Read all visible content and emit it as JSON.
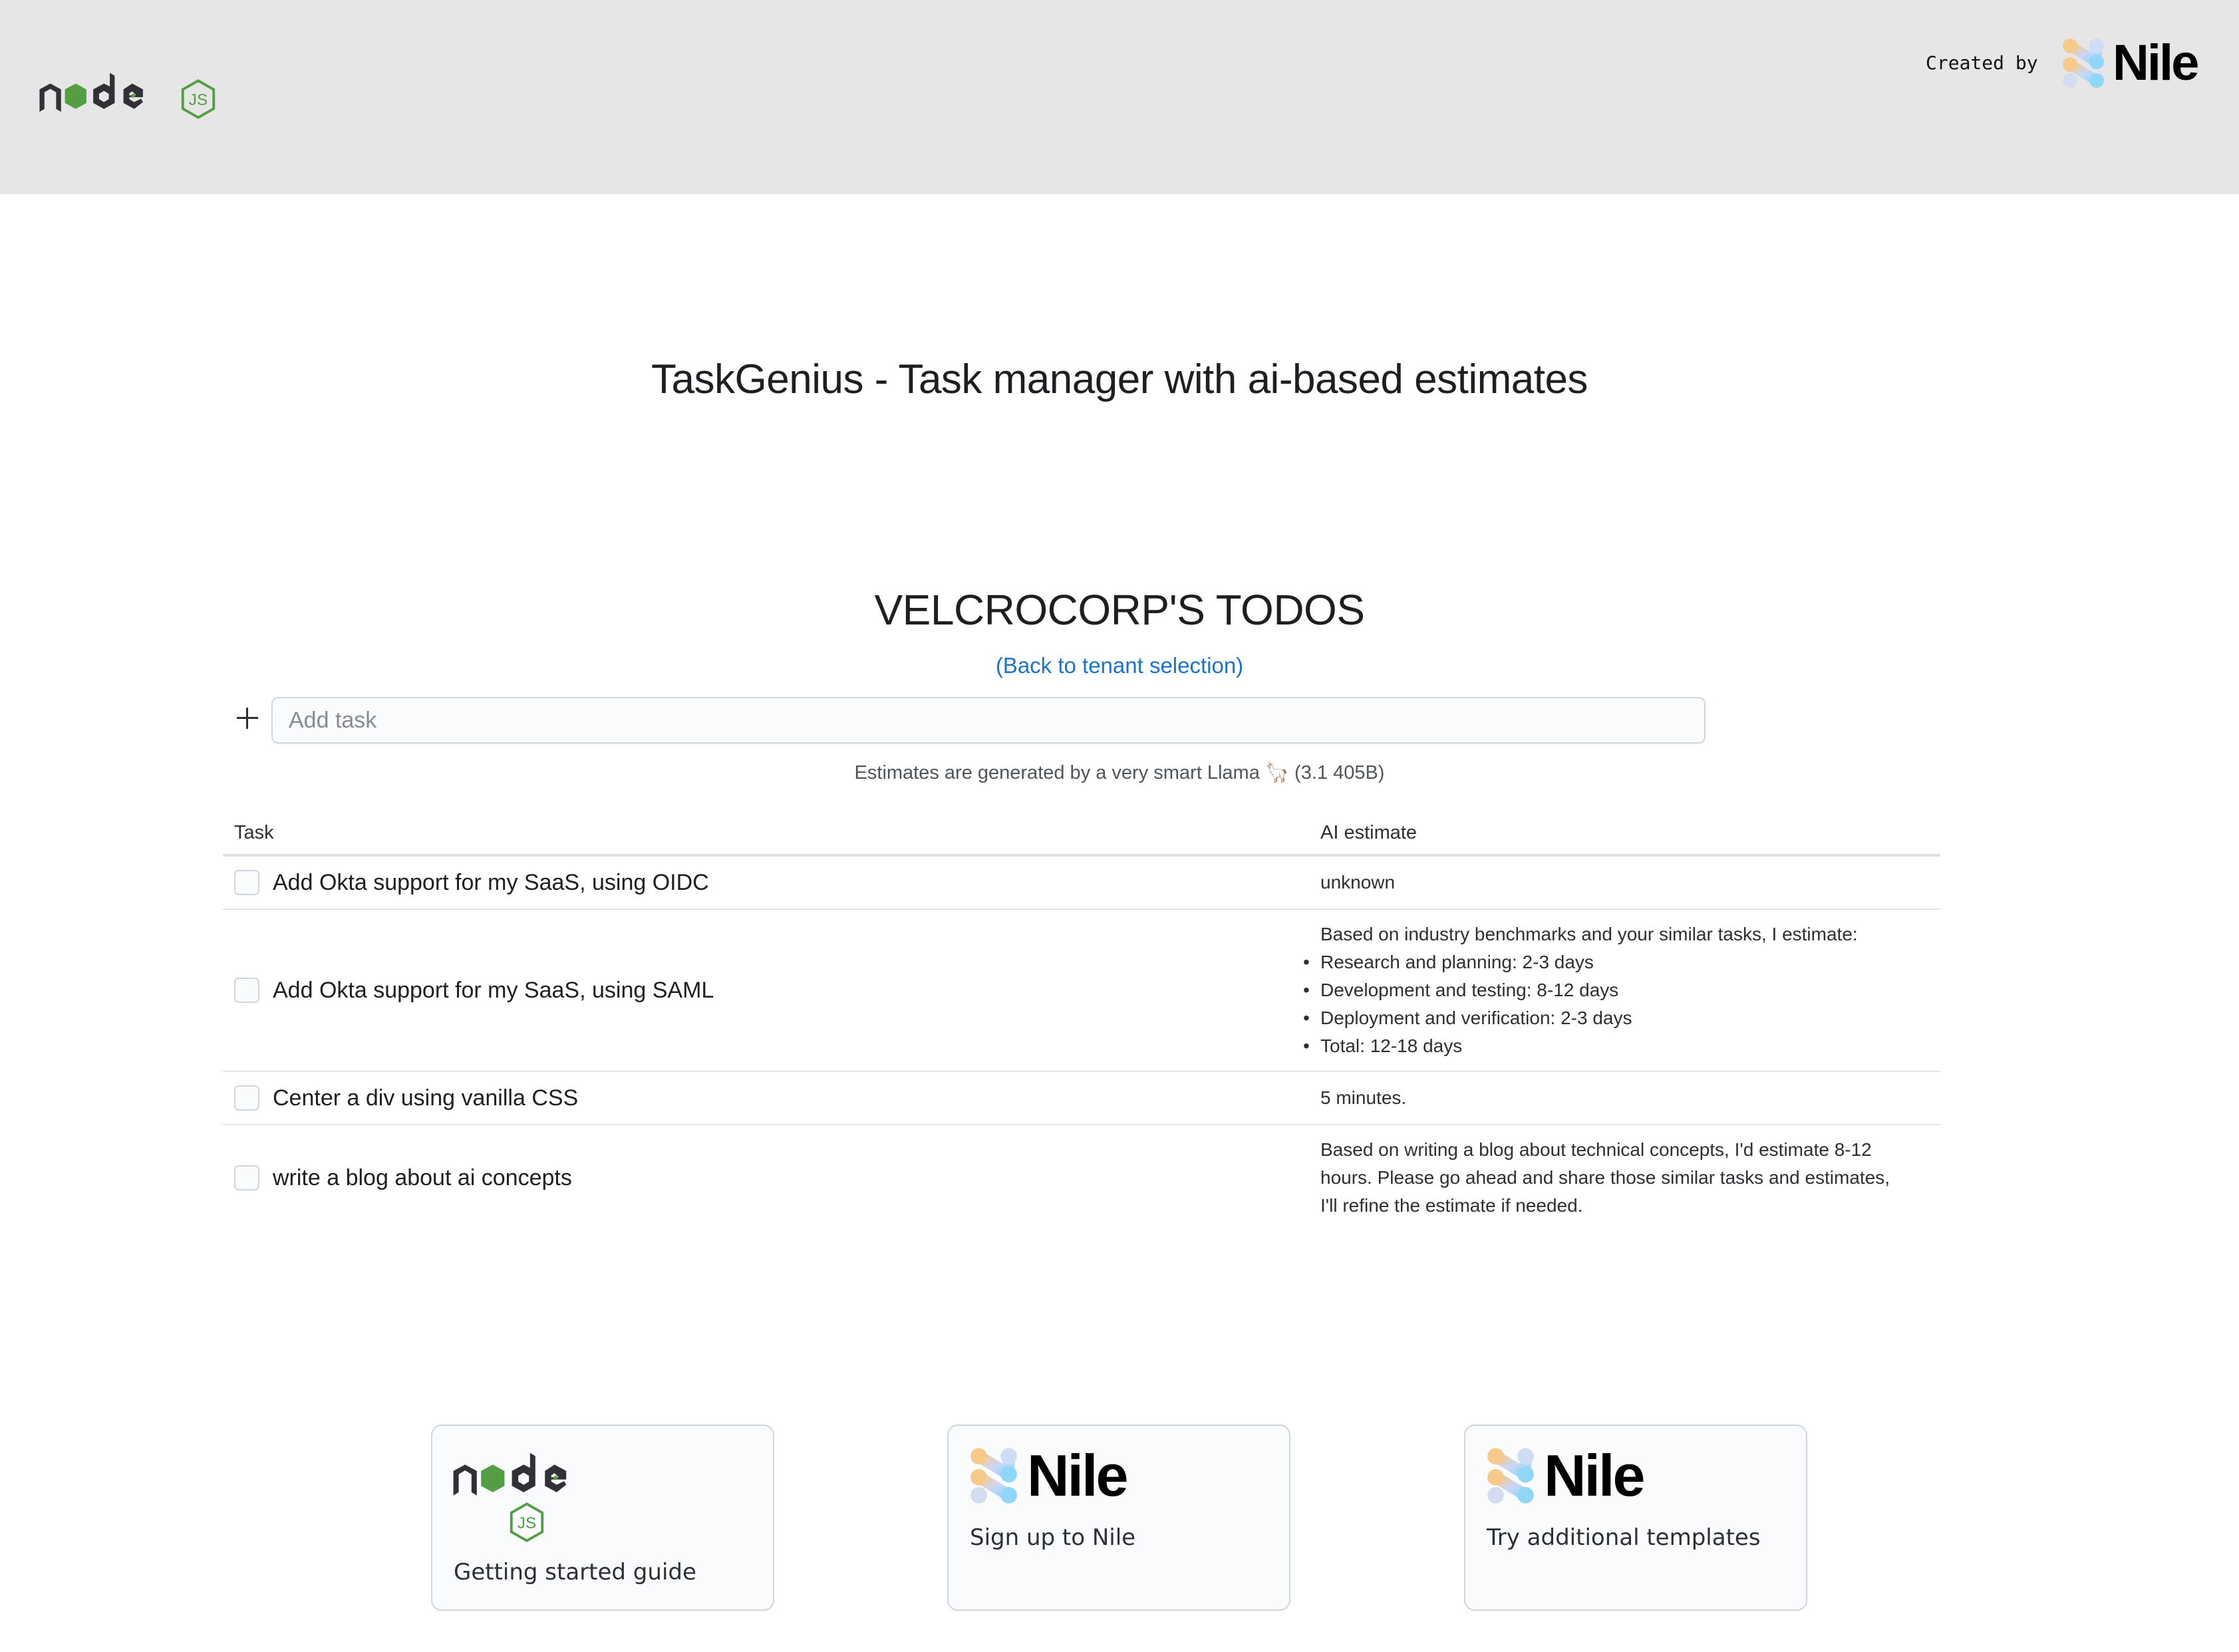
{
  "header": {
    "logo_name": "node-js-logo",
    "created_by_label": "Created by",
    "brand_logo_word": "Nile"
  },
  "main": {
    "app_title": "TaskGenius - Task manager with ai-based estimates",
    "tenant_title": "VELCROCORP'S TODOS",
    "back_link": "(Back to tenant selection)",
    "add_task": {
      "placeholder": "Add task",
      "value": ""
    },
    "estimates_note": "Estimates are generated by a very smart Llama 🦙 (3.1 405B)"
  },
  "table": {
    "columns": [
      "Task",
      "AI estimate"
    ],
    "rows": [
      {
        "task": "Add Okta support for my SaaS, using OIDC",
        "done": false,
        "estimate_text": "unknown",
        "estimate_list": []
      },
      {
        "task": "Add Okta support for my SaaS, using SAML",
        "done": false,
        "estimate_text": "Based on industry benchmarks and your similar tasks, I estimate:",
        "estimate_list": [
          "Research and planning: 2-3 days",
          "Development and testing: 8-12 days",
          "Deployment and verification: 2-3 days",
          "Total: 12-18 days"
        ]
      },
      {
        "task": "Center a div using vanilla CSS",
        "done": false,
        "estimate_text": "5 minutes.",
        "estimate_list": []
      },
      {
        "task": "write a blog about ai concepts",
        "done": false,
        "estimate_text": "Based on writing a blog about technical concepts, I'd estimate 8-12 hours. Please go ahead and share those similar tasks and estimates, I'll refine the estimate if needed.",
        "estimate_list": []
      }
    ]
  },
  "cards": [
    {
      "label": "Getting started guide",
      "logo": "node-js-logo"
    },
    {
      "label": "Sign up to Nile",
      "logo": "nile-logo",
      "logo_word": "Nile"
    },
    {
      "label": "Try additional templates",
      "logo": "nile-logo",
      "logo_word": "Nile"
    }
  ],
  "colors": {
    "header_bg": "#e6e6e6",
    "link": "#1a73d0",
    "node_green": "#539e43",
    "node_dark": "#2f3136",
    "nile_orange": "#f7c98a",
    "nile_blue": "#8fd6f9"
  }
}
